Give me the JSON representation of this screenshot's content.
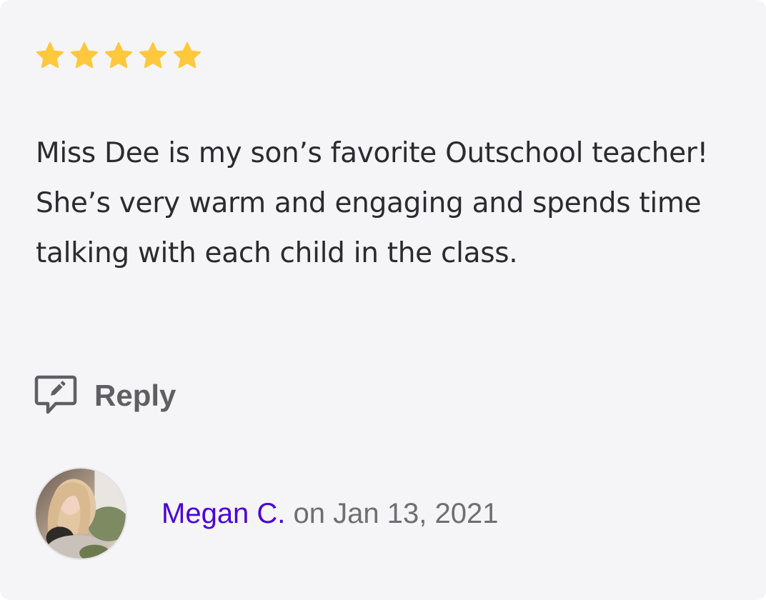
{
  "review": {
    "rating": 5,
    "rating_max": 5,
    "star_color": "#FFC83D",
    "text": "Miss Dee is my son’s favorite Outschool teacher! She’s very warm and engaging and spends time talking with each child in the class.",
    "reply_label": "Reply",
    "reply_icon": "edit-comment-icon",
    "author": {
      "name": "Megan C.",
      "name_color": "#4B01D4",
      "date_prefix": "on",
      "date": "Jan 13, 2021"
    }
  }
}
